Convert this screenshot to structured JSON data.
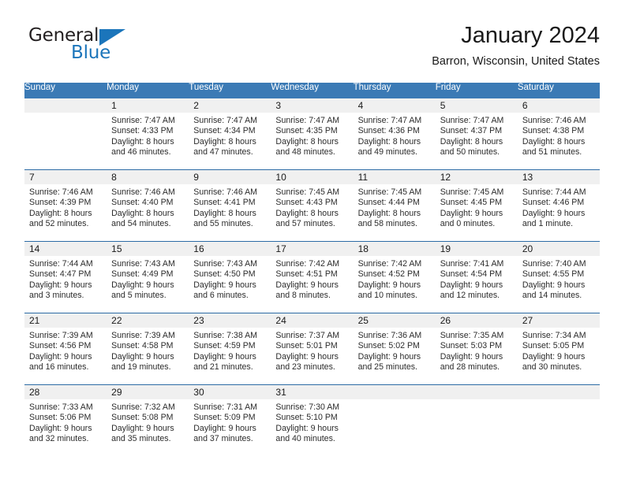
{
  "brand": {
    "name_top": "General",
    "name_bottom": "Blue",
    "triangle_icon": "triangle-icon",
    "colors": {
      "blue": "#1b75bb",
      "dark": "#231f20"
    }
  },
  "header": {
    "title": "January 2024",
    "subtitle": "Barron, Wisconsin, United States"
  },
  "theme": {
    "header_blue": "#3b7ab5",
    "row_divider_blue": "#2c6ba5",
    "daynum_band": "#f0f0f0",
    "text": "#2b2b2b"
  },
  "calendar": {
    "weekday_headers": [
      "Sunday",
      "Monday",
      "Tuesday",
      "Wednesday",
      "Thursday",
      "Friday",
      "Saturday"
    ],
    "weeks": [
      [
        {
          "day": "",
          "empty": true,
          "sunrise": "",
          "sunset": "",
          "daylight_line1": "",
          "daylight_line2": ""
        },
        {
          "day": "1",
          "sunrise": "Sunrise: 7:47 AM",
          "sunset": "Sunset: 4:33 PM",
          "daylight_line1": "Daylight: 8 hours",
          "daylight_line2": "and 46 minutes."
        },
        {
          "day": "2",
          "sunrise": "Sunrise: 7:47 AM",
          "sunset": "Sunset: 4:34 PM",
          "daylight_line1": "Daylight: 8 hours",
          "daylight_line2": "and 47 minutes."
        },
        {
          "day": "3",
          "sunrise": "Sunrise: 7:47 AM",
          "sunset": "Sunset: 4:35 PM",
          "daylight_line1": "Daylight: 8 hours",
          "daylight_line2": "and 48 minutes."
        },
        {
          "day": "4",
          "sunrise": "Sunrise: 7:47 AM",
          "sunset": "Sunset: 4:36 PM",
          "daylight_line1": "Daylight: 8 hours",
          "daylight_line2": "and 49 minutes."
        },
        {
          "day": "5",
          "sunrise": "Sunrise: 7:47 AM",
          "sunset": "Sunset: 4:37 PM",
          "daylight_line1": "Daylight: 8 hours",
          "daylight_line2": "and 50 minutes."
        },
        {
          "day": "6",
          "sunrise": "Sunrise: 7:46 AM",
          "sunset": "Sunset: 4:38 PM",
          "daylight_line1": "Daylight: 8 hours",
          "daylight_line2": "and 51 minutes."
        }
      ],
      [
        {
          "day": "7",
          "sunrise": "Sunrise: 7:46 AM",
          "sunset": "Sunset: 4:39 PM",
          "daylight_line1": "Daylight: 8 hours",
          "daylight_line2": "and 52 minutes."
        },
        {
          "day": "8",
          "sunrise": "Sunrise: 7:46 AM",
          "sunset": "Sunset: 4:40 PM",
          "daylight_line1": "Daylight: 8 hours",
          "daylight_line2": "and 54 minutes."
        },
        {
          "day": "9",
          "sunrise": "Sunrise: 7:46 AM",
          "sunset": "Sunset: 4:41 PM",
          "daylight_line1": "Daylight: 8 hours",
          "daylight_line2": "and 55 minutes."
        },
        {
          "day": "10",
          "sunrise": "Sunrise: 7:45 AM",
          "sunset": "Sunset: 4:43 PM",
          "daylight_line1": "Daylight: 8 hours",
          "daylight_line2": "and 57 minutes."
        },
        {
          "day": "11",
          "sunrise": "Sunrise: 7:45 AM",
          "sunset": "Sunset: 4:44 PM",
          "daylight_line1": "Daylight: 8 hours",
          "daylight_line2": "and 58 minutes."
        },
        {
          "day": "12",
          "sunrise": "Sunrise: 7:45 AM",
          "sunset": "Sunset: 4:45 PM",
          "daylight_line1": "Daylight: 9 hours",
          "daylight_line2": "and 0 minutes."
        },
        {
          "day": "13",
          "sunrise": "Sunrise: 7:44 AM",
          "sunset": "Sunset: 4:46 PM",
          "daylight_line1": "Daylight: 9 hours",
          "daylight_line2": "and 1 minute."
        }
      ],
      [
        {
          "day": "14",
          "sunrise": "Sunrise: 7:44 AM",
          "sunset": "Sunset: 4:47 PM",
          "daylight_line1": "Daylight: 9 hours",
          "daylight_line2": "and 3 minutes."
        },
        {
          "day": "15",
          "sunrise": "Sunrise: 7:43 AM",
          "sunset": "Sunset: 4:49 PM",
          "daylight_line1": "Daylight: 9 hours",
          "daylight_line2": "and 5 minutes."
        },
        {
          "day": "16",
          "sunrise": "Sunrise: 7:43 AM",
          "sunset": "Sunset: 4:50 PM",
          "daylight_line1": "Daylight: 9 hours",
          "daylight_line2": "and 6 minutes."
        },
        {
          "day": "17",
          "sunrise": "Sunrise: 7:42 AM",
          "sunset": "Sunset: 4:51 PM",
          "daylight_line1": "Daylight: 9 hours",
          "daylight_line2": "and 8 minutes."
        },
        {
          "day": "18",
          "sunrise": "Sunrise: 7:42 AM",
          "sunset": "Sunset: 4:52 PM",
          "daylight_line1": "Daylight: 9 hours",
          "daylight_line2": "and 10 minutes."
        },
        {
          "day": "19",
          "sunrise": "Sunrise: 7:41 AM",
          "sunset": "Sunset: 4:54 PM",
          "daylight_line1": "Daylight: 9 hours",
          "daylight_line2": "and 12 minutes."
        },
        {
          "day": "20",
          "sunrise": "Sunrise: 7:40 AM",
          "sunset": "Sunset: 4:55 PM",
          "daylight_line1": "Daylight: 9 hours",
          "daylight_line2": "and 14 minutes."
        }
      ],
      [
        {
          "day": "21",
          "sunrise": "Sunrise: 7:39 AM",
          "sunset": "Sunset: 4:56 PM",
          "daylight_line1": "Daylight: 9 hours",
          "daylight_line2": "and 16 minutes."
        },
        {
          "day": "22",
          "sunrise": "Sunrise: 7:39 AM",
          "sunset": "Sunset: 4:58 PM",
          "daylight_line1": "Daylight: 9 hours",
          "daylight_line2": "and 19 minutes."
        },
        {
          "day": "23",
          "sunrise": "Sunrise: 7:38 AM",
          "sunset": "Sunset: 4:59 PM",
          "daylight_line1": "Daylight: 9 hours",
          "daylight_line2": "and 21 minutes."
        },
        {
          "day": "24",
          "sunrise": "Sunrise: 7:37 AM",
          "sunset": "Sunset: 5:01 PM",
          "daylight_line1": "Daylight: 9 hours",
          "daylight_line2": "and 23 minutes."
        },
        {
          "day": "25",
          "sunrise": "Sunrise: 7:36 AM",
          "sunset": "Sunset: 5:02 PM",
          "daylight_line1": "Daylight: 9 hours",
          "daylight_line2": "and 25 minutes."
        },
        {
          "day": "26",
          "sunrise": "Sunrise: 7:35 AM",
          "sunset": "Sunset: 5:03 PM",
          "daylight_line1": "Daylight: 9 hours",
          "daylight_line2": "and 28 minutes."
        },
        {
          "day": "27",
          "sunrise": "Sunrise: 7:34 AM",
          "sunset": "Sunset: 5:05 PM",
          "daylight_line1": "Daylight: 9 hours",
          "daylight_line2": "and 30 minutes."
        }
      ],
      [
        {
          "day": "28",
          "sunrise": "Sunrise: 7:33 AM",
          "sunset": "Sunset: 5:06 PM",
          "daylight_line1": "Daylight: 9 hours",
          "daylight_line2": "and 32 minutes."
        },
        {
          "day": "29",
          "sunrise": "Sunrise: 7:32 AM",
          "sunset": "Sunset: 5:08 PM",
          "daylight_line1": "Daylight: 9 hours",
          "daylight_line2": "and 35 minutes."
        },
        {
          "day": "30",
          "sunrise": "Sunrise: 7:31 AM",
          "sunset": "Sunset: 5:09 PM",
          "daylight_line1": "Daylight: 9 hours",
          "daylight_line2": "and 37 minutes."
        },
        {
          "day": "31",
          "sunrise": "Sunrise: 7:30 AM",
          "sunset": "Sunset: 5:10 PM",
          "daylight_line1": "Daylight: 9 hours",
          "daylight_line2": "and 40 minutes."
        },
        {
          "day": "",
          "empty": true,
          "sunrise": "",
          "sunset": "",
          "daylight_line1": "",
          "daylight_line2": ""
        },
        {
          "day": "",
          "empty": true,
          "sunrise": "",
          "sunset": "",
          "daylight_line1": "",
          "daylight_line2": ""
        },
        {
          "day": "",
          "empty": true,
          "sunrise": "",
          "sunset": "",
          "daylight_line1": "",
          "daylight_line2": ""
        }
      ]
    ]
  }
}
